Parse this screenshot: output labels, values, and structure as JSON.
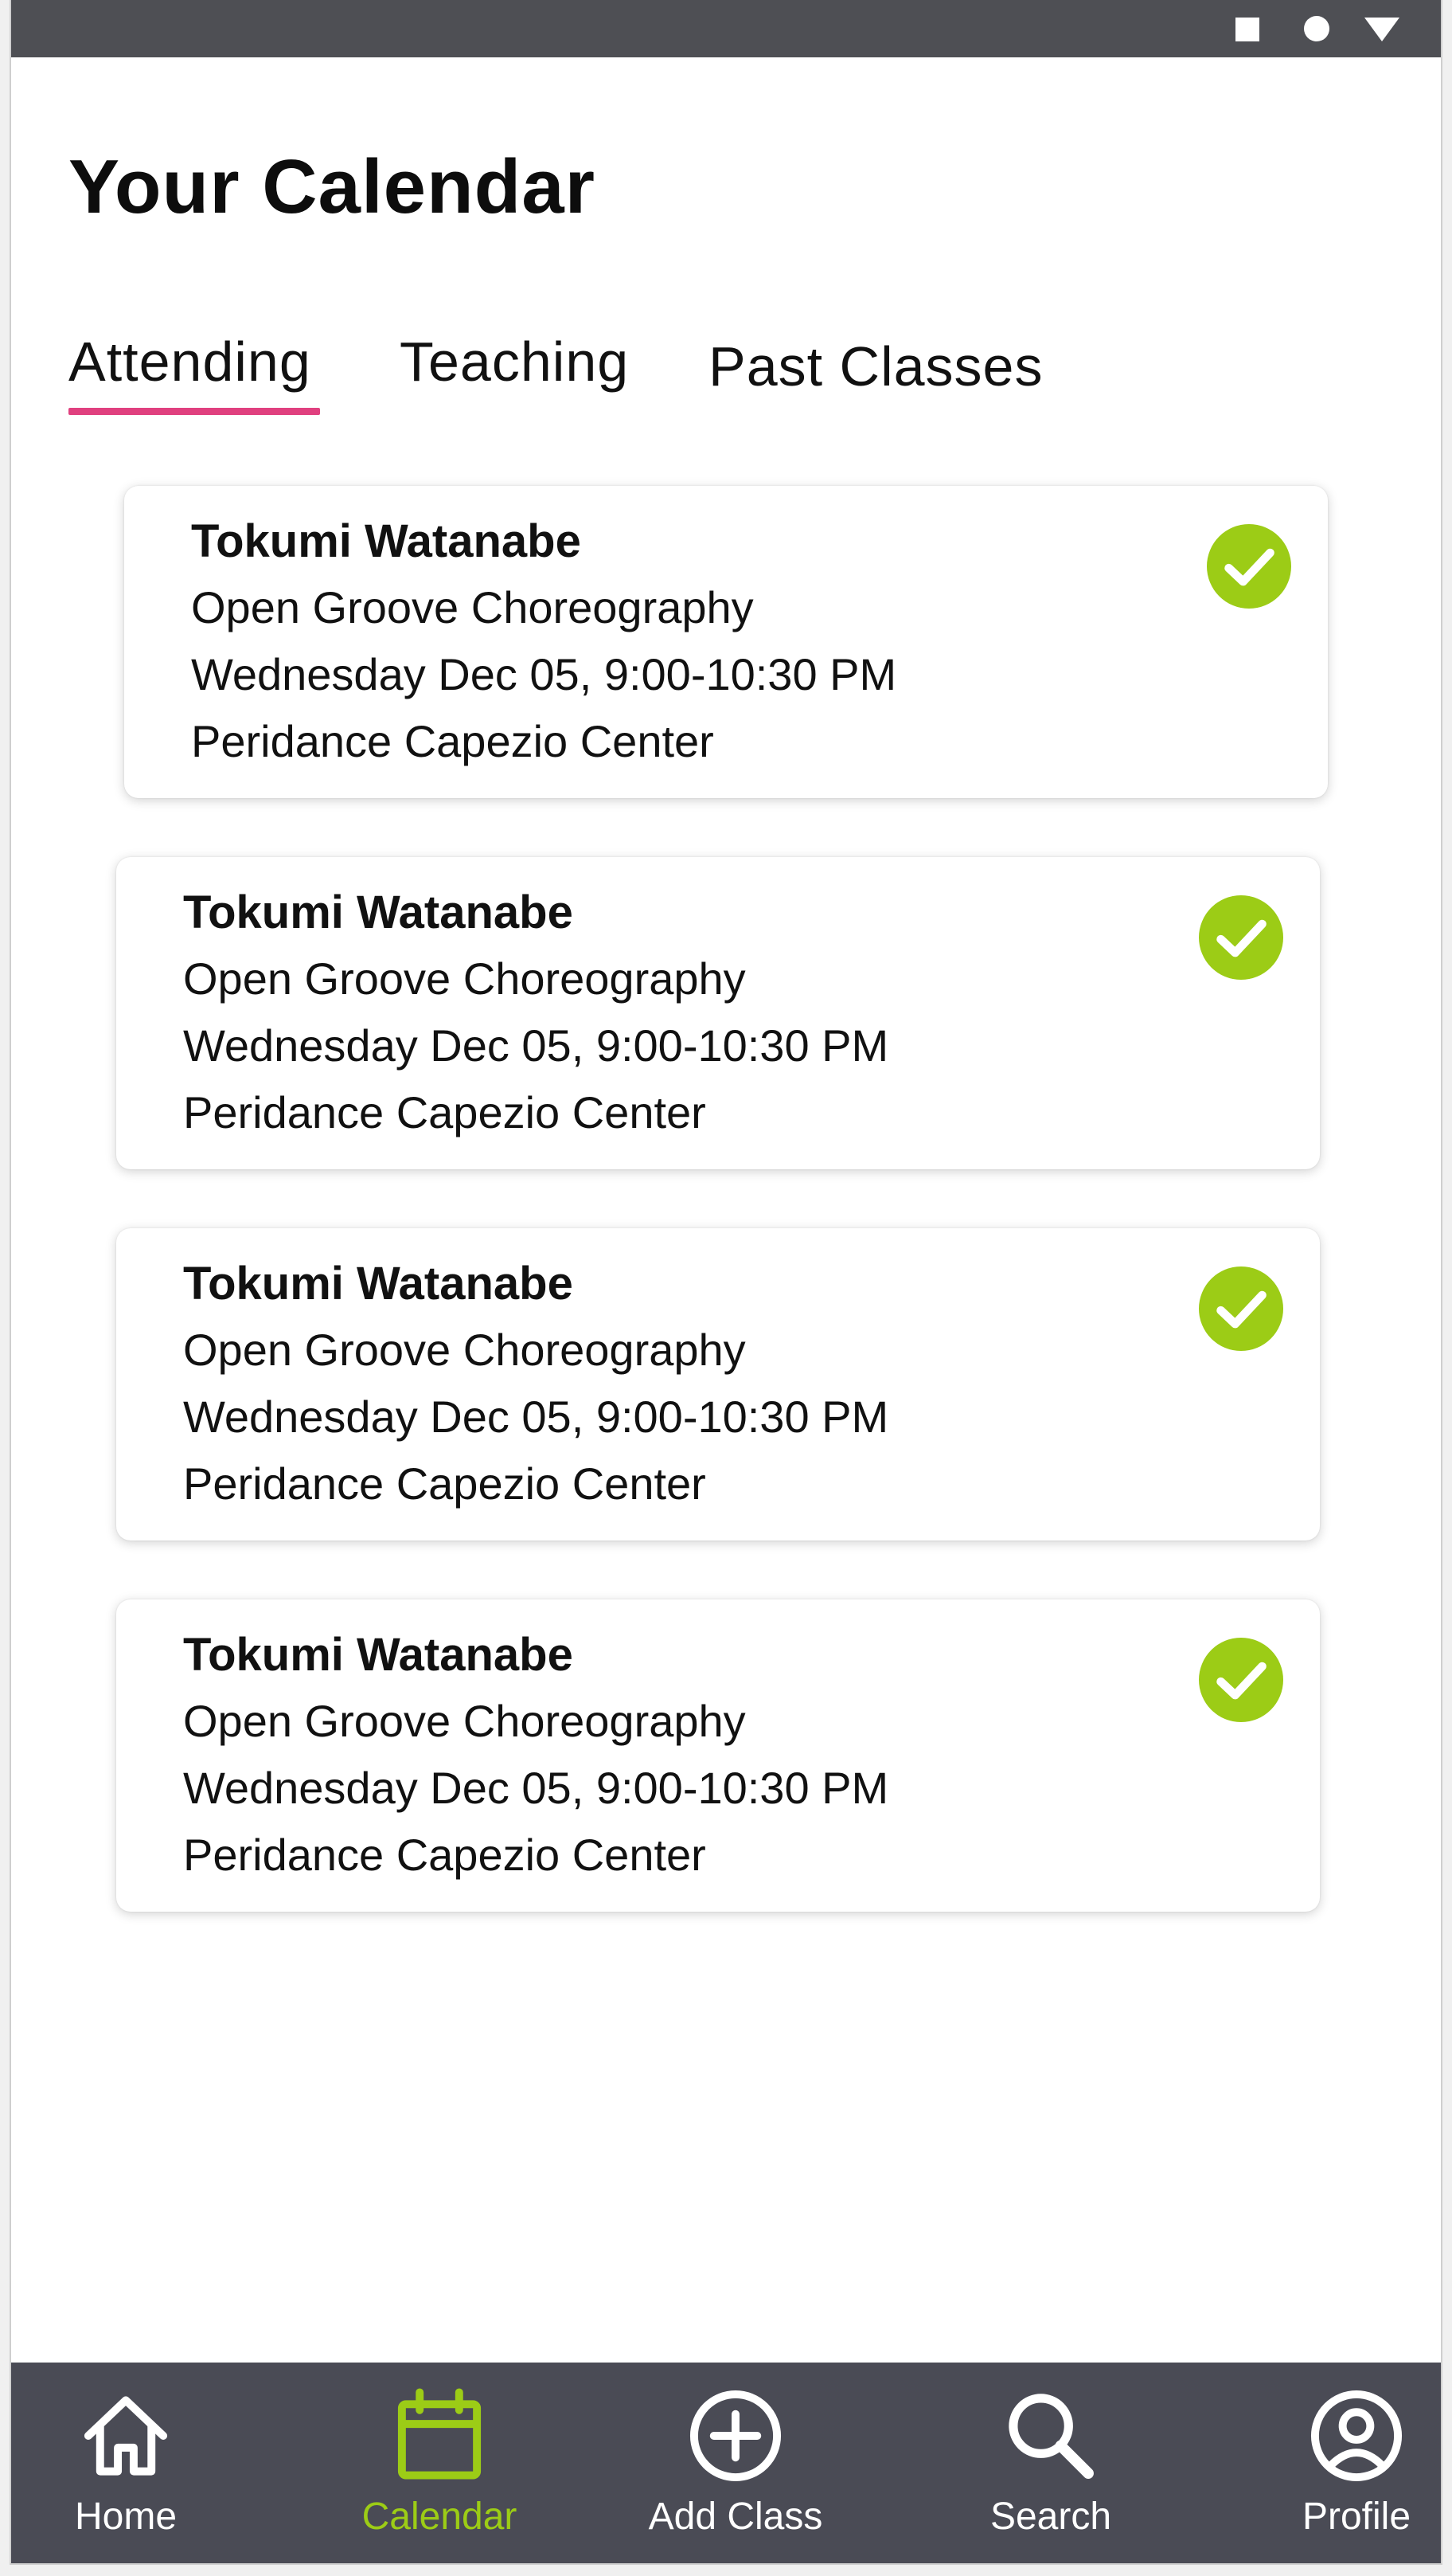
{
  "colors": {
    "status_bar": "#4e4f54",
    "tab_underline": "#e0407f",
    "check_green": "#9ccc16",
    "nav_background": "#4a4b55",
    "nav_active": "#9ccc16",
    "nav_inactive": "#ffffff"
  },
  "status_bar": {
    "icons": [
      "square-icon",
      "circle-icon",
      "triangle-icon"
    ]
  },
  "page": {
    "title": "Your Calendar"
  },
  "tabs": [
    {
      "label": "Attending",
      "active": true
    },
    {
      "label": "Teaching",
      "active": false
    },
    {
      "label": "Past Classes",
      "active": false
    }
  ],
  "cards": [
    {
      "instructor": "Tokumi Watanabe",
      "class_name": "Open Groove Choreography",
      "datetime": "Wednesday Dec 05, 9:00-10:30 PM",
      "location": "Peridance Capezio Center",
      "status_icon": "check-circle-icon"
    },
    {
      "instructor": "Tokumi Watanabe",
      "class_name": "Open Groove Choreography",
      "datetime": "Wednesday Dec 05, 9:00-10:30 PM",
      "location": "Peridance Capezio Center",
      "status_icon": "check-circle-icon"
    },
    {
      "instructor": "Tokumi Watanabe",
      "class_name": "Open Groove Choreography",
      "datetime": "Wednesday Dec 05, 9:00-10:30 PM",
      "location": "Peridance Capezio Center",
      "status_icon": "check-circle-icon"
    },
    {
      "instructor": "Tokumi Watanabe",
      "class_name": "Open Groove Choreography",
      "datetime": "Wednesday Dec 05, 9:00-10:30 PM",
      "location": "Peridance Capezio Center",
      "status_icon": "check-circle-icon"
    }
  ],
  "bottom_nav": [
    {
      "label": "Home",
      "icon": "home-icon",
      "active": false
    },
    {
      "label": "Calendar",
      "icon": "calendar-icon",
      "active": true
    },
    {
      "label": "Add Class",
      "icon": "add-circle-icon",
      "active": false
    },
    {
      "label": "Search",
      "icon": "search-icon",
      "active": false
    },
    {
      "label": "Profile",
      "icon": "profile-icon",
      "active": false
    }
  ]
}
